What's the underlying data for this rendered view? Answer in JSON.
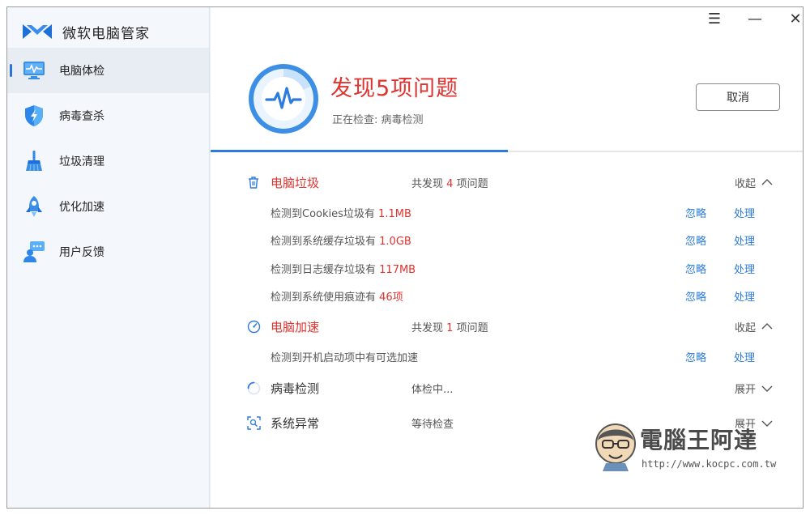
{
  "app": {
    "title": "微软电脑管家"
  },
  "window_controls": {
    "menu": "☰",
    "minimize": "—",
    "close": "✕"
  },
  "sidebar": {
    "items": [
      {
        "label": "电脑体检",
        "icon": "monitor-pulse-icon",
        "active": true
      },
      {
        "label": "病毒查杀",
        "icon": "shield-lightning-icon",
        "active": false
      },
      {
        "label": "垃圾清理",
        "icon": "broom-icon",
        "active": false
      },
      {
        "label": "优化加速",
        "icon": "rocket-icon",
        "active": false
      },
      {
        "label": "用户反馈",
        "icon": "feedback-user-icon",
        "active": false
      }
    ]
  },
  "header": {
    "title": "发现5项问题",
    "subtitle": "正在检查: 病毒检测",
    "cancel_label": "取消",
    "progress_fraction": 0.5
  },
  "groups": {
    "junk": {
      "title": "电脑垃圾",
      "summary_prefix": "共发现",
      "summary_count": "4",
      "summary_suffix": "项问题",
      "toggle": "收起",
      "rows": [
        {
          "text": "检测到Cookies垃圾有",
          "value": "1.1MB",
          "ignore": "忽略",
          "handle": "处理"
        },
        {
          "text": "检测到系统缓存垃圾有",
          "value": "1.0GB",
          "ignore": "忽略",
          "handle": "处理"
        },
        {
          "text": "检测到日志缓存垃圾有",
          "value": "117MB",
          "ignore": "忽略",
          "handle": "处理"
        },
        {
          "text": "检测到系统使用痕迹有",
          "value": "46项",
          "ignore": "忽略",
          "handle": "处理"
        }
      ]
    },
    "speed": {
      "title": "电脑加速",
      "summary_prefix": "共发现",
      "summary_count": "1",
      "summary_suffix": "项问题",
      "toggle": "收起",
      "rows": [
        {
          "text": "检测到开机启动项中有可选加速",
          "value": "",
          "ignore": "忽略",
          "handle": "处理"
        }
      ]
    },
    "virus": {
      "title": "病毒检测",
      "status": "体检中...",
      "toggle": "展开"
    },
    "system": {
      "title": "系统异常",
      "status": "等待检查",
      "toggle": "展开"
    }
  },
  "watermark": {
    "text": "電腦王阿達",
    "url": "http://www.kocpc.com.tw"
  },
  "colors": {
    "accent": "#2d7bdf",
    "alert": "#e0322e"
  }
}
